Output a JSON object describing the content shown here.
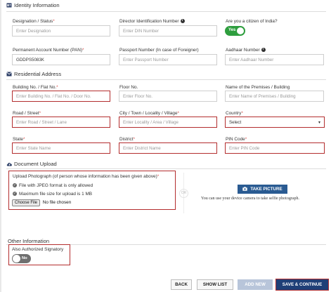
{
  "identity": {
    "title": "Identity Information",
    "designation": {
      "label": "Designation / Status",
      "placeholder": "Enter Designation"
    },
    "din": {
      "label": "Director Identification Number",
      "placeholder": "Enter DIN Number"
    },
    "citizen": {
      "label": "Are you a citizen of India?",
      "toggle": "Yes"
    },
    "pan": {
      "label": "Permanent Account Number (PAN)",
      "value": "GDDPS5083K"
    },
    "passport": {
      "label": "Passport Number (In case of Foreigner)",
      "placeholder": "Enter Passport Number"
    },
    "aadhaar": {
      "label": "Aadhaar Number",
      "placeholder": "Enter Aadhaar Number"
    }
  },
  "residential": {
    "title": "Residential Address",
    "building": {
      "label": "Building No. / Flat No.",
      "placeholder": "Enter Building No. / Flat No. / Door No."
    },
    "floor": {
      "label": "Floor No.",
      "placeholder": "Enter Floor No."
    },
    "premises": {
      "label": "Name of the Premises / Building",
      "placeholder": "Enter Name of Premises / Building"
    },
    "road": {
      "label": "Road / Street",
      "placeholder": "Enter Road / Street / Lane"
    },
    "city": {
      "label": "City / Town / Locality / Village",
      "placeholder": "Enter Locality / Area / Village"
    },
    "country": {
      "label": "Country",
      "selected": "Select"
    },
    "state": {
      "label": "State",
      "placeholder": "Enter State Name"
    },
    "district": {
      "label": "District",
      "placeholder": "Enter District Name"
    },
    "pin": {
      "label": "PIN Code",
      "placeholder": "Enter PIN Code"
    }
  },
  "document": {
    "title": "Document Upload",
    "upload_label": "Upload Photograph (of person whose information has been given above)",
    "note1": "File with JPEG format is only allowed",
    "note2": "Maximum file size for upload is 1 MB",
    "choose_label": "Choose File",
    "no_file": "No file chosen",
    "or": "OR",
    "take_picture": "TAKE PICTURE",
    "camera_note": "You can use your device camera to take selfie photograph."
  },
  "other": {
    "title": "Other Information",
    "signatory_label": "Also Authorized Signatory",
    "toggle": "No"
  },
  "actions": {
    "back": "BACK",
    "show_list": "SHOW LIST",
    "add_new": "ADD NEW",
    "save": "SAVE & CONTINUE"
  },
  "colors": {
    "error_border": "#b32d2e",
    "toggle_on": "#2e9e3e",
    "primary": "#1f3f77",
    "take_picture": "#2a5b92"
  }
}
